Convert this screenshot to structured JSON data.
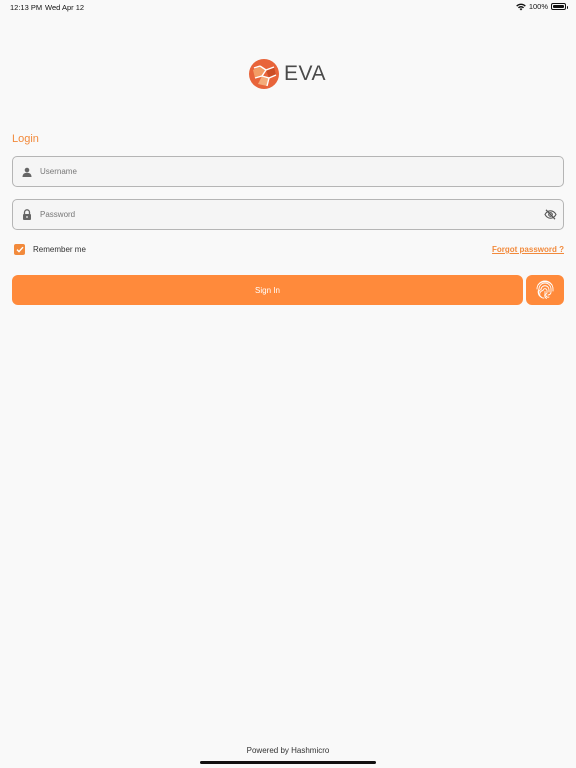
{
  "status_bar": {
    "time": "12:13 PM",
    "date": "Wed Apr 12",
    "battery_text": "100%",
    "battery_level": 1.0,
    "wifi_icon": "wifi-icon",
    "battery_icon": "battery-icon"
  },
  "logo": {
    "text": "EVA",
    "mark_icon": "eva-logo-icon",
    "mark_color": "#e8643a"
  },
  "login": {
    "title": "Login",
    "username": {
      "placeholder": "Username",
      "value": "",
      "icon": "person-icon"
    },
    "password": {
      "placeholder": "Password",
      "value": "",
      "icon": "lock-icon",
      "toggle_icon": "eye-off-icon"
    },
    "remember": {
      "label": "Remember me",
      "checked": true
    },
    "forgot_label": "Forgot password ?",
    "signin_label": "Sign In",
    "fingerprint_icon": "fingerprint-icon"
  },
  "footer": {
    "powered_by": "Powered by Hashmicro"
  },
  "colors": {
    "accent": "#ff8a3b",
    "accent_text": "#f28a3c",
    "background": "#f9f9f9"
  }
}
